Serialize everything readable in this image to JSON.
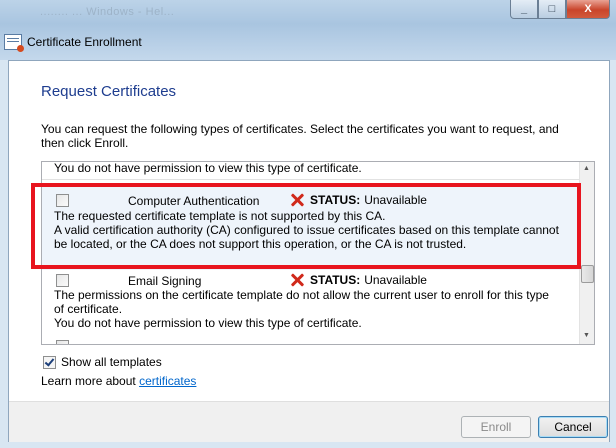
{
  "window": {
    "title": "Certificate Enrollment",
    "bg_text": "........ ... Windows - Hel...",
    "buttons": {
      "minimize": "_",
      "maximize": "□",
      "close": "X"
    }
  },
  "page": {
    "heading": "Request Certificates",
    "intro": "You can request the following types of certificates. Select the certificates you want to request, and then click Enroll."
  },
  "list": {
    "partial_top": "You do not have permission to view this type of certificate.",
    "items": [
      {
        "name": "Computer Authentication",
        "status_label": "STATUS:",
        "status_value": "Unavailable",
        "desc_lines": [
          "The requested certificate template is not supported by this CA.",
          "A valid certification authority (CA) configured to issue certificates based on this template cannot",
          "be located, or the CA does not support this operation, or the CA is not trusted."
        ]
      },
      {
        "name": "Email Signing",
        "status_label": "STATUS:",
        "status_value": "Unavailable",
        "desc_lines": [
          "The permissions on the certificate template do not allow the current user to enroll for this type",
          "of certificate.",
          "You do not have permission to view this type of certificate."
        ]
      }
    ]
  },
  "options": {
    "show_all_label": "Show all templates",
    "show_all_checked": true,
    "learn_prefix": "Learn more about ",
    "learn_link": "certificates"
  },
  "footer": {
    "enroll": "Enroll",
    "cancel": "Cancel"
  },
  "colors": {
    "heading": "#1e3d8f",
    "highlight": "#e8141e",
    "status_x": "#d0291b",
    "link": "#0066cc"
  }
}
